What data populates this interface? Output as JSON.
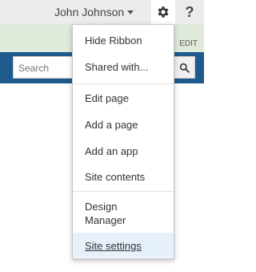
{
  "topbar": {
    "user_name": "John Johnson",
    "settings_icon": "gear-icon",
    "help_label": "?"
  },
  "ribbon": {
    "edit_label": "EDIT"
  },
  "search": {
    "placeholder": "Search",
    "button_icon": "search-icon"
  },
  "settings_menu": {
    "items": [
      {
        "label": "Hide Ribbon"
      },
      {
        "label": "Shared with..."
      },
      {
        "label": "Edit page"
      },
      {
        "label": "Add a page"
      },
      {
        "label": "Add an app"
      },
      {
        "label": "Site contents"
      },
      {
        "label": "Design Manager"
      },
      {
        "label": "Site settings",
        "selected": true
      }
    ]
  },
  "colors": {
    "topbar_bg": "#ececec",
    "ribbon_bg": "#dfeadb",
    "suitebar_bg": "#1f5a8c",
    "selected_item_bg": "#e6f1fb"
  }
}
